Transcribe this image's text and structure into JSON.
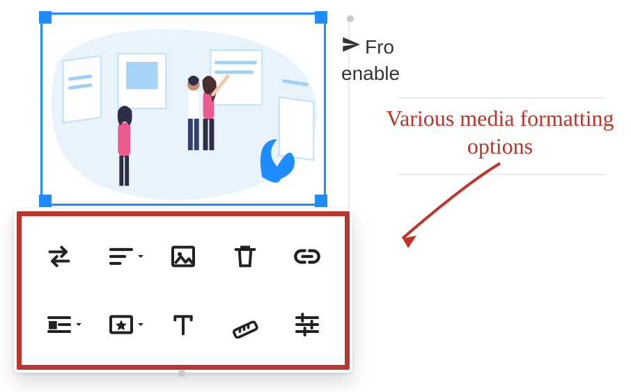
{
  "cropped_text": {
    "line1": "Fro",
    "line2": "enable"
  },
  "annotation": {
    "text": "Various media formatting options"
  },
  "toolbar": {
    "row1": [
      {
        "name": "swap"
      },
      {
        "name": "align",
        "hasDropdown": true
      },
      {
        "name": "image"
      },
      {
        "name": "delete"
      },
      {
        "name": "link"
      }
    ],
    "row2": [
      {
        "name": "wrap-text",
        "hasDropdown": true
      },
      {
        "name": "featured",
        "hasDropdown": true
      },
      {
        "name": "text-style"
      },
      {
        "name": "measure"
      },
      {
        "name": "settings"
      }
    ]
  },
  "colors": {
    "selection": "#1f8cff",
    "highlight": "#b9372e",
    "annotation": "#c43128",
    "icon": "#222222",
    "illoBg": "#e8f3fc",
    "illoAccent": "#1f8cff"
  }
}
